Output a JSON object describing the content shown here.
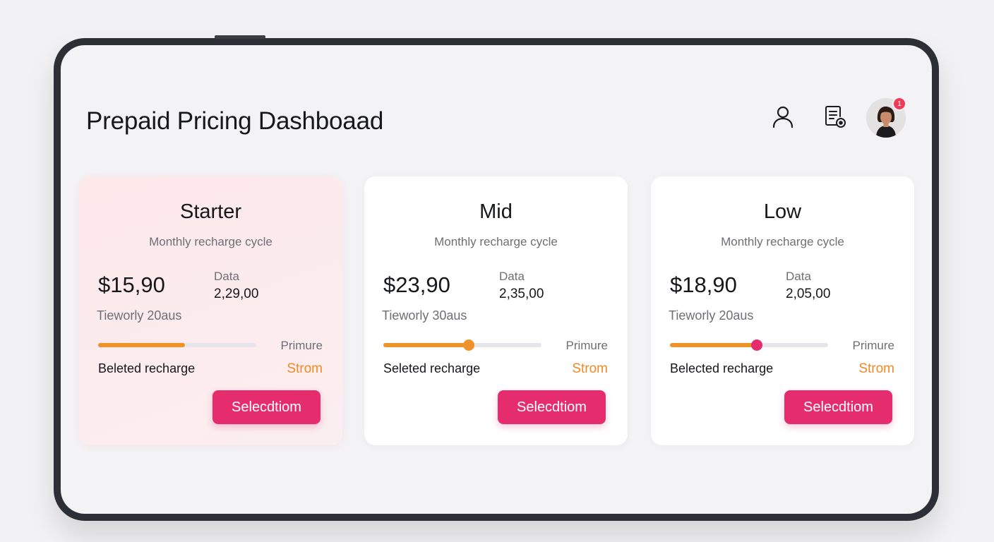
{
  "header": {
    "title": "Prepaid Pricing Dashboaad",
    "icons": [
      "user-icon",
      "document-settings-icon"
    ],
    "notification_count": "1"
  },
  "colors": {
    "accent": "#e52d6e",
    "progress": "#f0922a",
    "highlight_card": "#fce9ec"
  },
  "plans": [
    {
      "name": "Starter",
      "subtitle": "Monthly recharge cycle",
      "price": "$15,90",
      "data_label": "Data",
      "data_value": "2,29,00",
      "term": "Tieworly 20aus",
      "progress": 0.55,
      "knob_color": "",
      "prime_label": "Primure",
      "recharge_label": "Beleted recharge",
      "status": "Strom",
      "button_label": "Selecdtiom"
    },
    {
      "name": "Mid",
      "subtitle": "Monthly recharge cycle",
      "price": "$23,90",
      "data_label": "Data",
      "data_value": "2,35,00",
      "term": "Tieworly 30aus",
      "progress": 0.54,
      "knob_color": "#f0922a",
      "prime_label": "Primure",
      "recharge_label": "Seleted recharge",
      "status": "Strom",
      "button_label": "Selecdtiom"
    },
    {
      "name": "Low",
      "subtitle": "Monthly recharge cycle",
      "price": "$18,90",
      "data_label": "Data",
      "data_value": "2,05,00",
      "term": "Tieworly 20aus",
      "progress": 0.55,
      "knob_color": "#e52d6e",
      "prime_label": "Primure",
      "recharge_label": "Belected recharge",
      "status": "Strom",
      "button_label": "Selecdtiom"
    }
  ]
}
